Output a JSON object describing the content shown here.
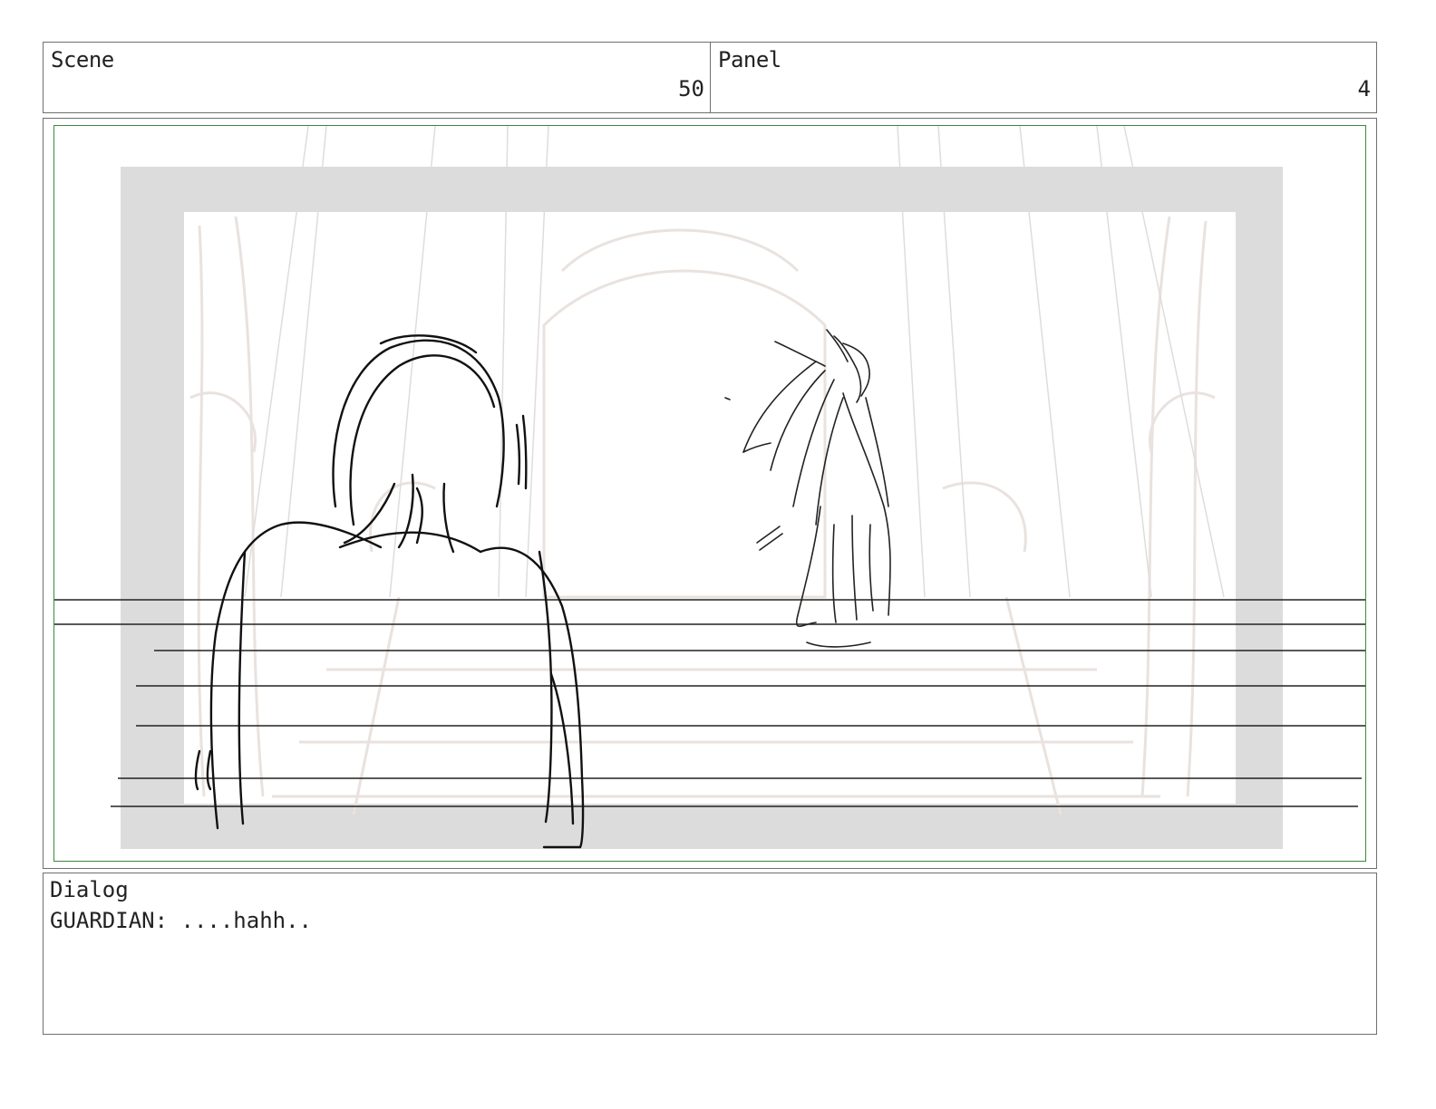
{
  "scene": {
    "label": "Scene",
    "number": "50"
  },
  "panel": {
    "label": "Panel",
    "number": "4"
  },
  "dialog": {
    "label": "Dialog",
    "text": "GUARDIAN: ....hahh.."
  },
  "colors": {
    "frame_border": "#6f6f6f",
    "safe_area_border": "#3b8a3b",
    "title_safe_fill": "#dcdcdc",
    "sketch_line": "#111111",
    "background_sketch": "#e9e2de"
  },
  "artwork": {
    "description_names": [
      "background-architecture-sketch",
      "foreground-figure-back-view",
      "distant-guardian-figure",
      "horizontal-guide-lines"
    ]
  }
}
